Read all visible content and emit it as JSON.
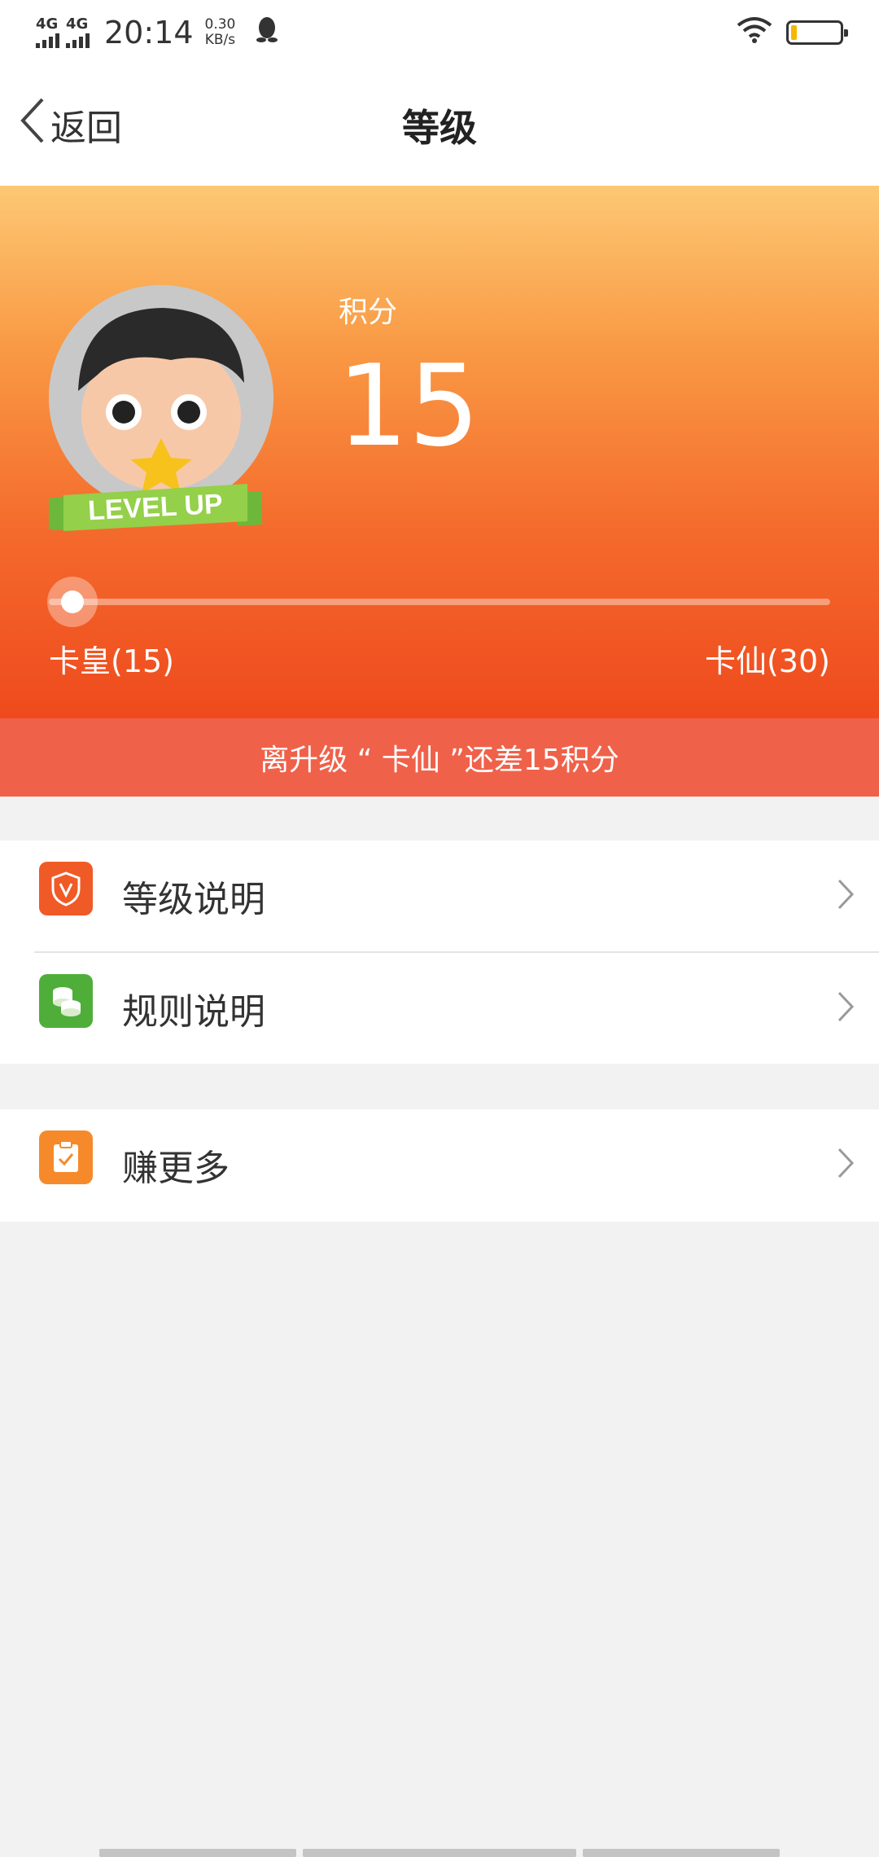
{
  "status_bar": {
    "network1": "4G",
    "network2": "4G",
    "time": "20:14",
    "speed_value": "0.30",
    "speed_unit": "KB/s",
    "battery_level_pct": 12
  },
  "nav": {
    "back_label": "返回",
    "title": "等级"
  },
  "hero": {
    "score_label": "积分",
    "score_value": "15",
    "ribbon_text": "LEVEL UP",
    "current_level": "卡皇(15)",
    "next_level": "卡仙(30)",
    "progress_fraction": 0.0
  },
  "tip": {
    "text": "离升级 “ 卡仙 ”还差15积分"
  },
  "menu_group1": [
    {
      "label": "等级说明",
      "icon": "shield-v-icon",
      "color": "#f05a26"
    },
    {
      "label": "规则说明",
      "icon": "coins-icon",
      "color": "#4fae3a"
    }
  ],
  "menu_group2": [
    {
      "label": "赚更多",
      "icon": "clipboard-check-icon",
      "color": "#f68a2a"
    }
  ]
}
